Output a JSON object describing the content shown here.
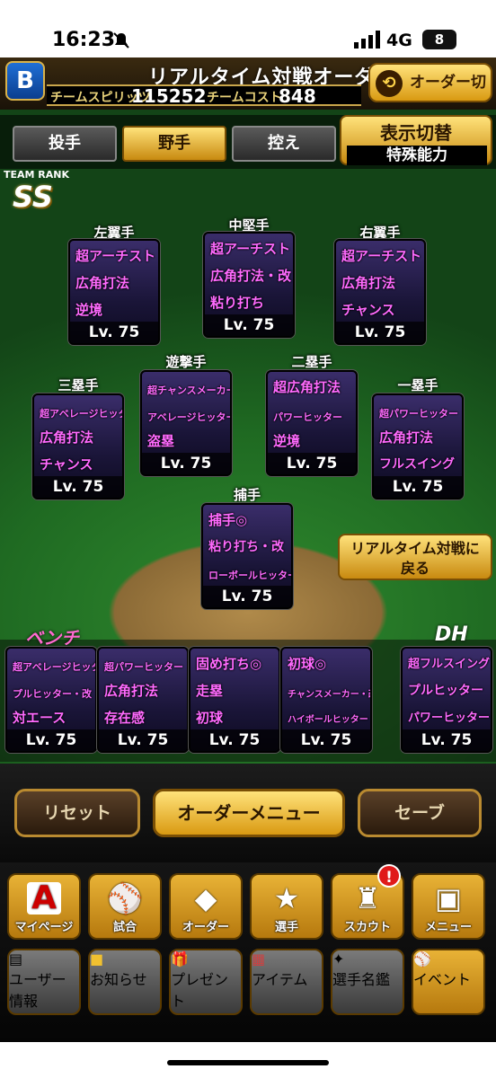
{
  "status_bar": {
    "time": "16:23",
    "network": "4G",
    "battery": "8"
  },
  "header": {
    "title": "リアルタイム対戦オーダー",
    "logo_letter": "B",
    "team_spirits_label": "チームスピリッツ",
    "team_spirits_value": "115252",
    "team_cost_label": "チームコスト",
    "team_cost_value": "848",
    "order_switch_label": "オーダー切替"
  },
  "tabs": [
    {
      "label": "投手",
      "active": false
    },
    {
      "label": "野手",
      "active": true
    },
    {
      "label": "控え",
      "active": false
    }
  ],
  "display_toggle": {
    "label": "表示切替",
    "value": "特殊能力"
  },
  "team_rank": {
    "label": "TEAM RANK",
    "value": "SS"
  },
  "fielders": {
    "lf": {
      "pos": "左翼手",
      "skills": [
        "超アーチスト",
        "広角打法",
        "逆境"
      ],
      "level": "Lv. 75"
    },
    "cf": {
      "pos": "中堅手",
      "skills": [
        "超アーチスト",
        "広角打法・改",
        "粘り打ち"
      ],
      "level": "Lv. 75"
    },
    "rf": {
      "pos": "右翼手",
      "skills": [
        "超アーチスト",
        "広角打法",
        "チャンス"
      ],
      "level": "Lv. 75"
    },
    "b3": {
      "pos": "三塁手",
      "skills": [
        "超アベレージヒッター",
        "広角打法",
        "チャンス"
      ],
      "level": "Lv. 75"
    },
    "ss": {
      "pos": "遊撃手",
      "skills": [
        "超チャンスメーカー",
        "アベレージヒッター",
        "盗塁"
      ],
      "level": "Lv. 75"
    },
    "b2": {
      "pos": "二塁手",
      "skills": [
        "超広角打法",
        "パワーヒッター",
        "逆境"
      ],
      "level": "Lv. 75"
    },
    "b1": {
      "pos": "一塁手",
      "skills": [
        "超パワーヒッター",
        "広角打法",
        "フルスイング"
      ],
      "level": "Lv. 75"
    },
    "c": {
      "pos": "捕手",
      "skills": [
        "捕手◎",
        "粘り打ち・改",
        "ローボールヒッター"
      ],
      "level": "Lv. 75"
    }
  },
  "return_button": {
    "line1": "リアルタイム対戦に",
    "line2": "戻る"
  },
  "bench": {
    "label": "ベンチ",
    "dh_label": "DH",
    "cards": [
      {
        "skills": [
          "超アベレージヒッター",
          "プルヒッター・改",
          "対エース"
        ],
        "level": "Lv. 75"
      },
      {
        "skills": [
          "超パワーヒッター",
          "広角打法",
          "存在感"
        ],
        "level": "Lv. 75"
      },
      {
        "skills": [
          "固め打ち◎",
          "走塁",
          "初球"
        ],
        "level": "Lv. 75"
      },
      {
        "skills": [
          "初球◎",
          "チャンスメーカー・改",
          "ハイボールヒッター"
        ],
        "level": "Lv. 75"
      },
      {
        "skills": [
          "超フルスイング",
          "プルヒッター",
          "パワーヒッター"
        ],
        "level": "Lv. 75"
      }
    ]
  },
  "controls": {
    "reset": "リセット",
    "order_menu": "オーダーメニュー",
    "save": "セーブ"
  },
  "nav_top": [
    {
      "label": "マイページ",
      "icon": "A"
    },
    {
      "label": "試合",
      "icon": "⚾"
    },
    {
      "label": "オーダー",
      "icon": "◆"
    },
    {
      "label": "選手",
      "icon": "★"
    },
    {
      "label": "スカウト",
      "icon": "♜"
    },
    {
      "label": "メニュー",
      "icon": "▣"
    }
  ],
  "nav_notif": "!",
  "nav_bottom": [
    {
      "label": "ユーザー情報",
      "icon": "▤"
    },
    {
      "label": "お知らせ",
      "icon": "■"
    },
    {
      "label": "プレゼント",
      "icon": "🎁"
    },
    {
      "label": "アイテム",
      "icon": "▦"
    },
    {
      "label": "選手名鑑",
      "icon": "✦"
    },
    {
      "label": "イベント",
      "icon": "⚾"
    }
  ],
  "colors": {
    "accent_gold": "#d99a12",
    "skill_pink": "#ff6aff",
    "bg_dark": "#0a0a0a"
  }
}
